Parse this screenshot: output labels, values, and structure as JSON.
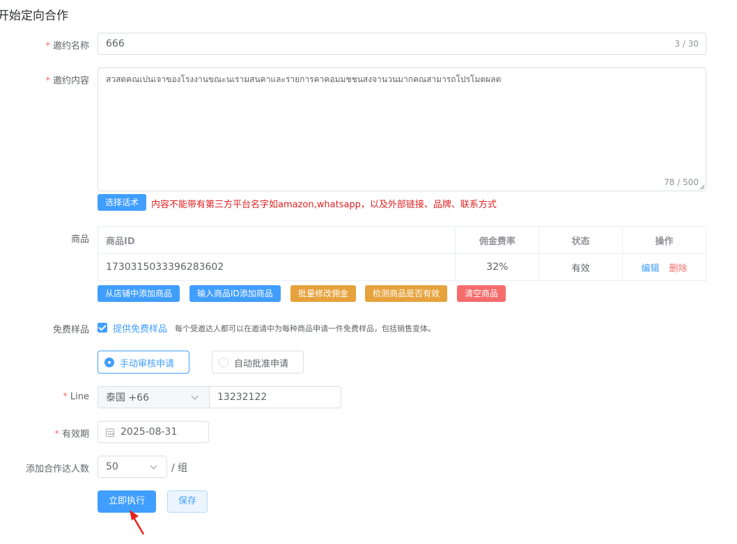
{
  "page": {
    "title": "开始定向合作"
  },
  "form": {
    "name": {
      "label": "邀约名称",
      "value": "666",
      "counter": "3 / 30"
    },
    "content": {
      "label": "邀约内容",
      "value": "สวสดคณเปนเจาของโรงงานขณะนเรามสนคาและรายการคาคอมมชชนสงจานวนมากคณสามารถโปรโมตผลต",
      "counter": "78 / 500",
      "select_script_label": "选择话术",
      "warning": "内容不能带有第三方平台名字如amazon,whatsapp，以及外部链接、品牌、联系方式"
    },
    "goods": {
      "label": "商品",
      "columns": [
        "商品ID",
        "佣金费率",
        "状态",
        "操作"
      ],
      "rows": [
        {
          "id": "1730315033396283602",
          "rate": "32%",
          "status": "有效",
          "edit": "编辑",
          "delete": "删除"
        }
      ],
      "buttons": {
        "add_from_store": "从店铺中添加商品",
        "add_by_id": "输入商品ID添加商品",
        "batch_commission": "批量修改佣金",
        "check_valid": "检测商品是否有效",
        "clear": "清空商品"
      }
    },
    "free_sample": {
      "label": "免费样品",
      "checkbox_label": "提供免费样品",
      "checked": true,
      "description": "每个受邀达人都可以在邀请中为每种商品申请一件免费样品，包括销售变体。",
      "options": [
        {
          "label": "手动审核申请",
          "selected": true
        },
        {
          "label": "自动批准申请",
          "selected": false
        }
      ]
    },
    "line": {
      "label": "Line",
      "country": "泰国 +66",
      "phone": "13232122"
    },
    "expiry": {
      "label": "有效期",
      "value": "2025-08-31"
    },
    "count": {
      "label": "添加合作达人数",
      "value": "50",
      "unit": "/ 组"
    },
    "actions": {
      "execute": "立即执行",
      "save": "保存"
    }
  },
  "colors": {
    "primary": "#409eff",
    "warning": "#e6a23c",
    "danger": "#f56c6c",
    "success": "#67c23a",
    "annotation_arrow": "#e8201c"
  }
}
